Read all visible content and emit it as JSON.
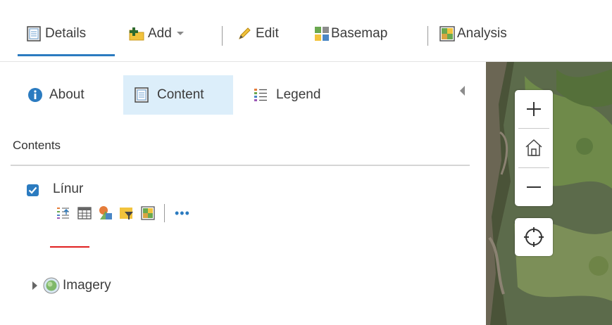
{
  "toolbar": {
    "details_label": "Details",
    "add_label": "Add",
    "edit_label": "Edit",
    "basemap_label": "Basemap",
    "analysis_label": "Analysis",
    "active_tab": "Details",
    "accent_color": "#2b7bc0"
  },
  "panel": {
    "tabs": [
      {
        "label": "About",
        "icon": "info-icon"
      },
      {
        "label": "Content",
        "icon": "content-icon",
        "active": true
      },
      {
        "label": "Legend",
        "icon": "legend-icon"
      }
    ],
    "heading": "Contents",
    "layers": [
      {
        "name": "Línur",
        "checked": true,
        "tools": [
          "show-table-icon",
          "table-icon",
          "change-style-icon",
          "filter-icon",
          "analysis-icon",
          "more-options-icon"
        ],
        "legend_color": "#e02020"
      },
      {
        "name": "Imagery",
        "icon": "globe-icon",
        "expanded": false
      }
    ]
  },
  "map": {
    "controls": [
      "zoom-in",
      "home",
      "zoom-out",
      "locate"
    ]
  }
}
